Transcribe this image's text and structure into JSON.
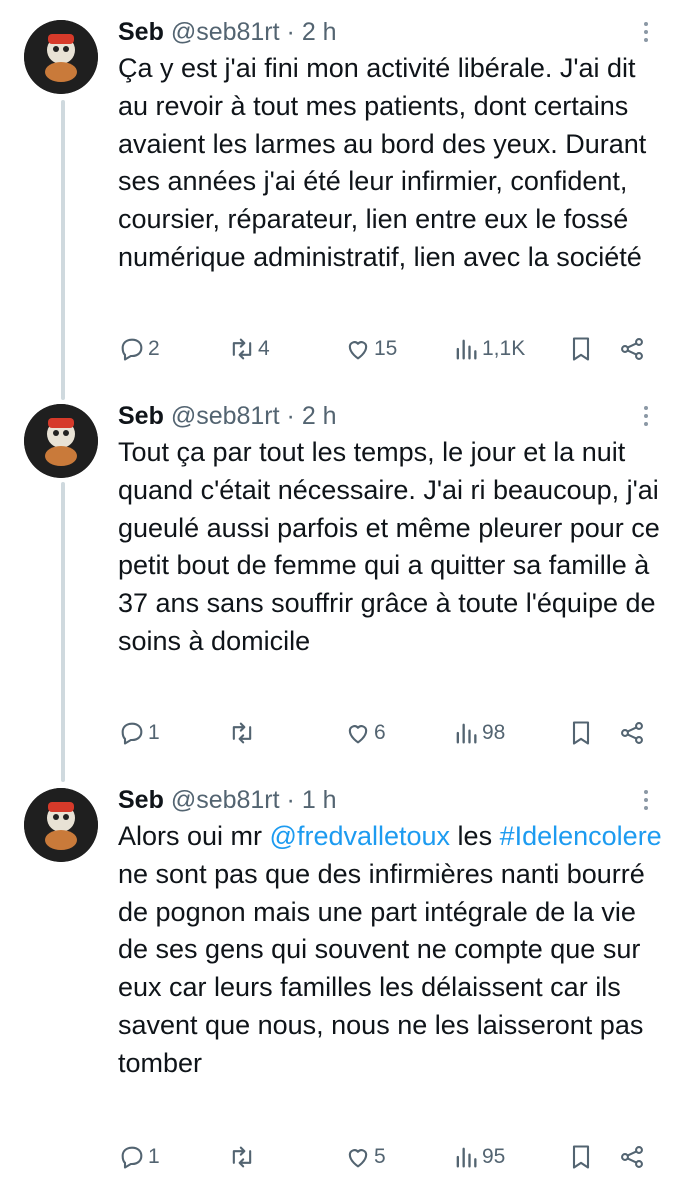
{
  "tweets": [
    {
      "name": "Seb",
      "handle": "@seb81rt",
      "time": "2 h",
      "body": [
        "Ça y est j'ai fini mon activité libérale. J'ai dit au revoir à tout mes patients, dont certains avaient les larmes au bord des yeux. Durant ses années j'ai été leur infirmier, confident, coursier, réparateur, lien entre eux le fossé numérique administratif, lien avec la société"
      ],
      "replies": "2",
      "retweets": "4",
      "likes": "15",
      "views": "1,1K"
    },
    {
      "name": "Seb",
      "handle": "@seb81rt",
      "time": "2 h",
      "body": [
        "Tout ça par tout les temps, le jour et la nuit quand c'était nécessaire. J'ai ri beaucoup, j'ai gueulé aussi parfois et même pleurer pour ce petit bout de femme qui a quitter sa famille à 37 ans sans souffrir grâce à toute l'équipe de soins à domicile"
      ],
      "replies": "1",
      "retweets": "",
      "likes": "6",
      "views": "98"
    },
    {
      "name": "Seb",
      "handle": "@seb81rt",
      "time": "1 h",
      "body_prefix": "Alors oui mr ",
      "mention": "@fredvalletoux",
      "body_mid": " les ",
      "hashtag": "#Idelencolere",
      "body_suffix": " ne sont pas que des infirmières nanti bourré de pognon mais une part intégrale de la vie de ses gens qui souvent ne compte que sur eux car leurs familles les délaissent car ils savent que nous, nous ne les laisseront pas tomber",
      "replies": "1",
      "retweets": "",
      "likes": "5",
      "views": "95"
    }
  ],
  "separator": "·",
  "colors": {
    "link": "#1d9bf0",
    "muted": "#536471",
    "thread_line": "#cfd9de"
  },
  "icons": [
    "reply-icon",
    "retweet-icon",
    "like-icon",
    "views-icon",
    "bookmark-icon",
    "share-icon",
    "more-icon"
  ]
}
